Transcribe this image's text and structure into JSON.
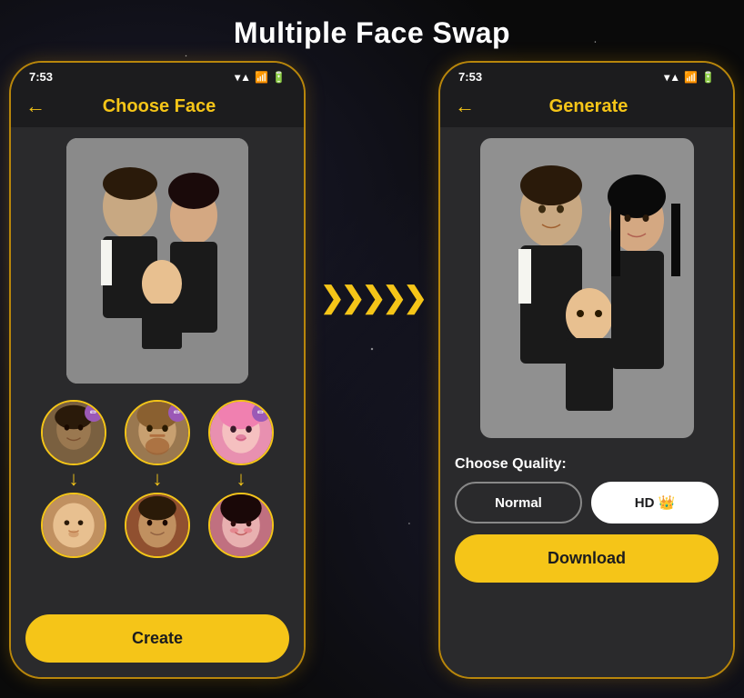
{
  "page": {
    "title": "Multiple Face Swap",
    "background_color": "#0a0a0a"
  },
  "phone1": {
    "status_time": "7:53",
    "header_title": "Choose Face",
    "back_label": "←",
    "create_button_label": "Create",
    "face_pairs": [
      {
        "id": 1,
        "source_color": "#6b5a3e",
        "target_color": "#e8c090",
        "has_edit": true
      },
      {
        "id": 2,
        "source_color": "#a07850",
        "target_color": "#c09060",
        "has_edit": true
      },
      {
        "id": 3,
        "source_color": "#e8a0a0",
        "target_color": "#d4a0a0",
        "has_edit": true
      }
    ]
  },
  "arrow": {
    "chevrons": "»»»»»"
  },
  "phone2": {
    "status_time": "7:53",
    "header_title": "Generate",
    "back_label": "←",
    "quality_label": "Choose Quality:",
    "quality_normal": "Normal",
    "quality_hd": "HD 👑",
    "download_button_label": "Download"
  }
}
